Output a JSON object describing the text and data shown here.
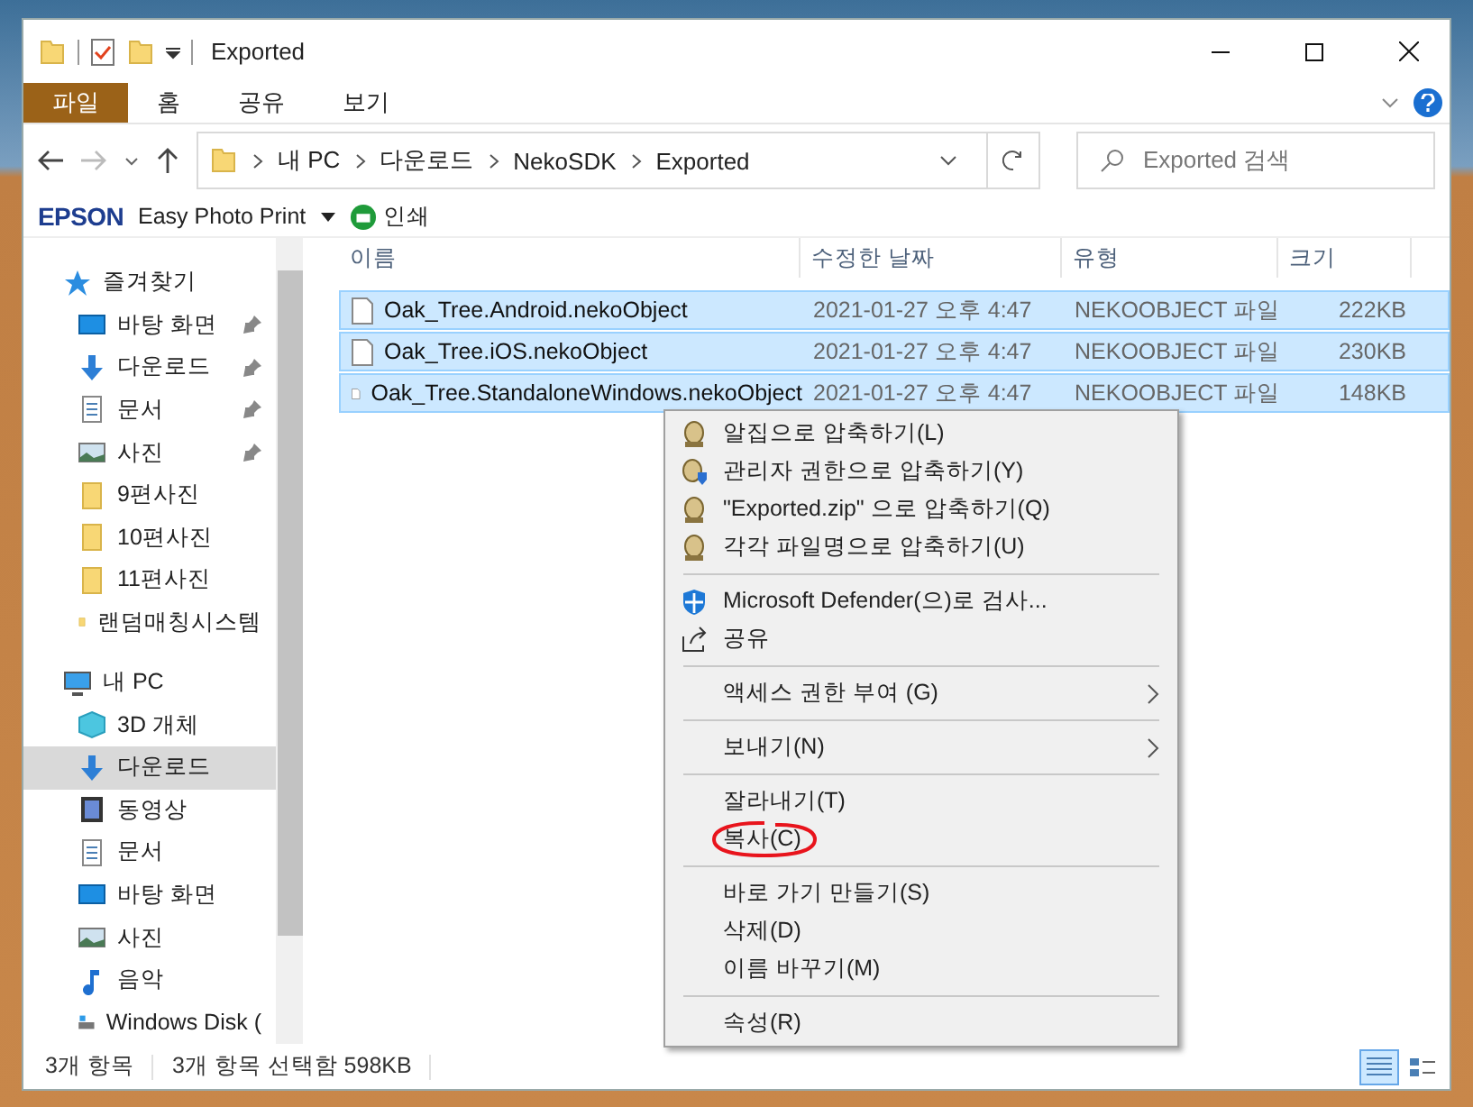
{
  "window": {
    "title": "Exported"
  },
  "ribbon_tabs": [
    {
      "label": "파일",
      "selected": true
    },
    {
      "label": "홈",
      "selected": false
    },
    {
      "label": "공유",
      "selected": false
    },
    {
      "label": "보기",
      "selected": false
    }
  ],
  "address": {
    "path": [
      "내 PC",
      "다운로드",
      "NekoSDK",
      "Exported"
    ]
  },
  "search": {
    "placeholder": "Exported 검색"
  },
  "toolbar": {
    "brand": "EPSON",
    "app": "Easy Photo Print",
    "print": "인쇄"
  },
  "sidebar": {
    "items": [
      {
        "label": "즐겨찾기",
        "kind": "star",
        "selected": false,
        "children": [
          {
            "label": "바탕 화면",
            "kind": "desktop",
            "pinned": true,
            "selected": false
          },
          {
            "label": "다운로드",
            "kind": "download",
            "pinned": true,
            "selected": false
          },
          {
            "label": "문서",
            "kind": "document",
            "pinned": true,
            "selected": false
          },
          {
            "label": "사진",
            "kind": "picture",
            "pinned": true,
            "selected": false
          },
          {
            "label": "9편사진",
            "kind": "folder",
            "pinned": false,
            "selected": false
          },
          {
            "label": "10편사진",
            "kind": "folder",
            "pinned": false,
            "selected": false
          },
          {
            "label": "11편사진",
            "kind": "folder",
            "pinned": false,
            "selected": false
          },
          {
            "label": "랜덤매칭시스템",
            "kind": "folder",
            "pinned": false,
            "selected": false
          }
        ]
      },
      {
        "label": "내 PC",
        "kind": "pc",
        "selected": false,
        "children": [
          {
            "label": "3D 개체",
            "kind": "cube",
            "pinned": false,
            "selected": false
          },
          {
            "label": "다운로드",
            "kind": "download",
            "pinned": false,
            "selected": true
          },
          {
            "label": "동영상",
            "kind": "video",
            "pinned": false,
            "selected": false
          },
          {
            "label": "문서",
            "kind": "document",
            "pinned": false,
            "selected": false
          },
          {
            "label": "바탕 화면",
            "kind": "desktop",
            "pinned": false,
            "selected": false
          },
          {
            "label": "사진",
            "kind": "picture",
            "pinned": false,
            "selected": false
          },
          {
            "label": "음악",
            "kind": "music",
            "pinned": false,
            "selected": false
          },
          {
            "label": "Windows Disk (",
            "kind": "drive",
            "pinned": false,
            "selected": false
          }
        ]
      }
    ]
  },
  "table": {
    "columns": [
      "이름",
      "수정한 날짜",
      "유형",
      "크기"
    ],
    "rows": [
      {
        "name": "Oak_Tree.Android.nekoObject",
        "date": "2021-01-27 오후 4:47",
        "type": "NEKOOBJECT 파일",
        "size": "222KB",
        "selected": true
      },
      {
        "name": "Oak_Tree.iOS.nekoObject",
        "date": "2021-01-27 오후 4:47",
        "type": "NEKOOBJECT 파일",
        "size": "230KB",
        "selected": true
      },
      {
        "name": "Oak_Tree.StandaloneWindows.nekoObject",
        "date": "2021-01-27 오후 4:47",
        "type": "NEKOOBJECT 파일",
        "size": "148KB",
        "selected": true
      }
    ]
  },
  "context_menu": {
    "groups": [
      [
        {
          "label": "알집으로 압축하기(L)",
          "kind": "zip",
          "submenu": false
        },
        {
          "label": "관리자 권한으로 압축하기(Y)",
          "kind": "zip-admin",
          "submenu": false
        },
        {
          "label": "\"Exported.zip\" 으로 압축하기(Q)",
          "kind": "zip",
          "submenu": false
        },
        {
          "label": "각각 파일명으로 압축하기(U)",
          "kind": "zip",
          "submenu": false
        }
      ],
      [
        {
          "label": "Microsoft Defender(으)로 검사...",
          "kind": "shield",
          "submenu": false
        },
        {
          "label": "공유",
          "kind": "share",
          "submenu": false
        }
      ],
      [
        {
          "label": "액세스 권한 부여 (G)",
          "kind": "plain",
          "submenu": true
        }
      ],
      [
        {
          "label": "보내기(N)",
          "kind": "plain",
          "submenu": true
        }
      ],
      [
        {
          "label": "잘라내기(T)",
          "kind": "plain",
          "submenu": false
        },
        {
          "label": "복사(C)",
          "kind": "plain",
          "submenu": false,
          "circled": true
        }
      ],
      [
        {
          "label": "바로 가기 만들기(S)",
          "kind": "plain",
          "submenu": false
        },
        {
          "label": "삭제(D)",
          "kind": "plain",
          "submenu": false
        },
        {
          "label": "이름 바꾸기(M)",
          "kind": "plain",
          "submenu": false
        }
      ],
      [
        {
          "label": "속성(R)",
          "kind": "plain",
          "submenu": false
        }
      ]
    ]
  },
  "status_bar": {
    "count": "3개 항목",
    "selection": "3개 항목 선택함 598KB"
  },
  "view_modes": [
    {
      "kind": "details",
      "selected": true
    },
    {
      "kind": "tiles",
      "selected": false
    }
  ]
}
